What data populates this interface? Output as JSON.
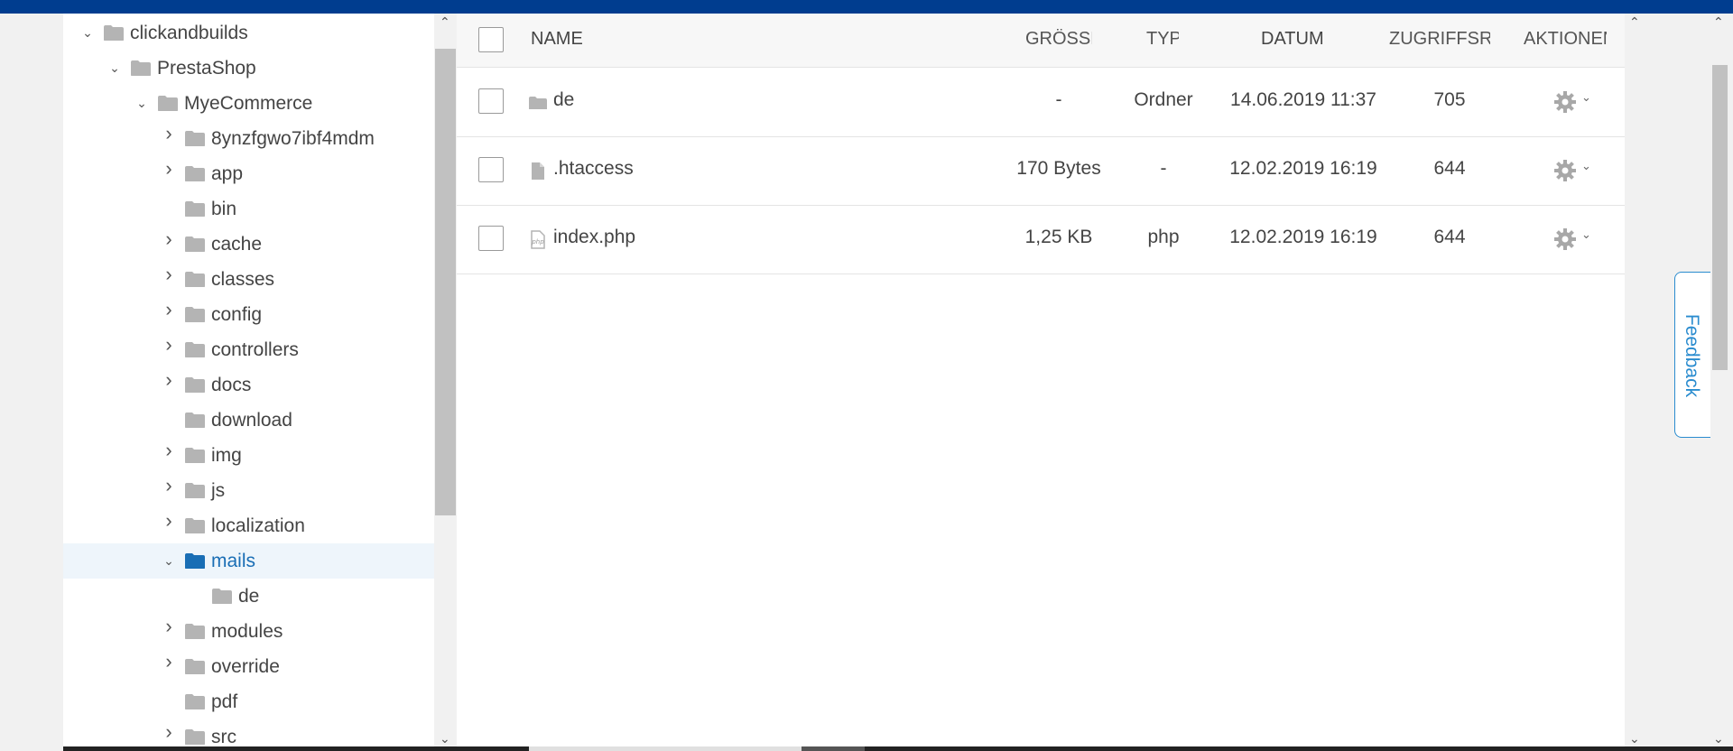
{
  "tree": {
    "items": [
      {
        "label": "clickandbuilds",
        "depth": 0,
        "chevron": "down"
      },
      {
        "label": "PrestaShop",
        "depth": 1,
        "chevron": "down"
      },
      {
        "label": "MyeCommerce",
        "depth": 2,
        "chevron": "down"
      },
      {
        "label": "8ynzfgwo7ibf4mdm",
        "depth": 3,
        "chevron": "right"
      },
      {
        "label": "app",
        "depth": 3,
        "chevron": "right"
      },
      {
        "label": "bin",
        "depth": 3,
        "chevron": "none"
      },
      {
        "label": "cache",
        "depth": 3,
        "chevron": "right"
      },
      {
        "label": "classes",
        "depth": 3,
        "chevron": "right"
      },
      {
        "label": "config",
        "depth": 3,
        "chevron": "right"
      },
      {
        "label": "controllers",
        "depth": 3,
        "chevron": "right"
      },
      {
        "label": "docs",
        "depth": 3,
        "chevron": "right"
      },
      {
        "label": "download",
        "depth": 3,
        "chevron": "none"
      },
      {
        "label": "img",
        "depth": 3,
        "chevron": "right"
      },
      {
        "label": "js",
        "depth": 3,
        "chevron": "right"
      },
      {
        "label": "localization",
        "depth": 3,
        "chevron": "right"
      },
      {
        "label": "mails",
        "depth": 3,
        "chevron": "down",
        "selected": true
      },
      {
        "label": "de",
        "depth": 4,
        "chevron": "none"
      },
      {
        "label": "modules",
        "depth": 3,
        "chevron": "right"
      },
      {
        "label": "override",
        "depth": 3,
        "chevron": "right"
      },
      {
        "label": "pdf",
        "depth": 3,
        "chevron": "none"
      },
      {
        "label": "src",
        "depth": 3,
        "chevron": "right"
      }
    ]
  },
  "table": {
    "headers": {
      "name": "NAME",
      "size": "GRÖSSE",
      "type": "TYP",
      "date": "DATUM",
      "permissions": "ZUGRIFFSREC",
      "actions": "AKTIONEN"
    },
    "rows": [
      {
        "name": "de",
        "icon": "folder-icon",
        "size": "-",
        "type": "Ordner",
        "date": "14.06.2019 11:37",
        "permissions": "705"
      },
      {
        "name": ".htaccess",
        "icon": "file-icon",
        "size": "170 Bytes",
        "type": "-",
        "date": "12.02.2019 16:19",
        "permissions": "644"
      },
      {
        "name": "index.php",
        "icon": "php-file-icon",
        "size": "1,25 KB",
        "type": "php",
        "date": "12.02.2019 16:19",
        "permissions": "644"
      }
    ]
  },
  "feedback": {
    "label": "Feedback"
  },
  "colors": {
    "topbar": "#003d8f",
    "accent": "#1a6eb5",
    "feedback": "#2a8ccf"
  }
}
